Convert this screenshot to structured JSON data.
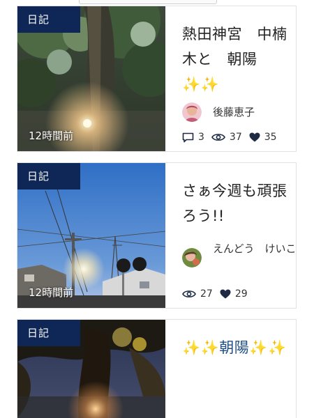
{
  "cards": [
    {
      "badge": "日記",
      "time": "12時間前",
      "title": "熱田神宮　中楠木と　朝陽✨✨",
      "author": "後藤恵子",
      "comments": "3",
      "views": "37",
      "likes": "35"
    },
    {
      "badge": "日記",
      "time": "12時間前",
      "title": "さぁ今週も頑張ろう!!",
      "author": "えんどう　けいこ",
      "views": "27",
      "likes": "29"
    },
    {
      "badge": "日記",
      "title": "✨✨朝陽✨✨"
    }
  ],
  "colors": {
    "badge_bg": "#0f2756",
    "link_title": "#1f4f86",
    "icon": "#1e2a44"
  }
}
